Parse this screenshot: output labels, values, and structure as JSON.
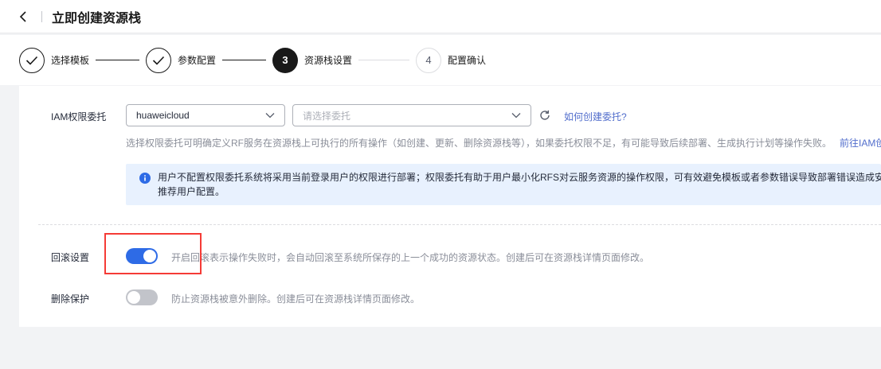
{
  "header": {
    "title": "立即创建资源栈"
  },
  "stepper": {
    "steps": [
      {
        "label": "选择模板",
        "state": "done"
      },
      {
        "label": "参数配置",
        "state": "done"
      },
      {
        "number": "3",
        "label": "资源栈设置",
        "state": "active"
      },
      {
        "number": "4",
        "label": "配置确认",
        "state": "pending"
      }
    ]
  },
  "iam": {
    "label": "IAM权限委托",
    "region_value": "huaweicloud",
    "delegation_placeholder": "请选择委托",
    "help_link": "如何创建委托?",
    "hint": "选择权限委托可明确定义RF服务在资源栈上可执行的所有操作（如创建、更新、删除资源栈等），如果委托权限不足，有可能导致后续部署、生成执行计划等操作失败。",
    "hint_link": "前往IAM创",
    "notice_line1": "用户不配置权限委托系统将采用当前登录用户的权限进行部署；权限委托有助于用户最小化RFS对云服务资源的操作权限，可有效避免模板或者参数错误导致部署错误造成安",
    "notice_line2": "推荐用户配置。"
  },
  "rollback": {
    "label": "回滚设置",
    "enabled": true,
    "description": "开启回滚表示操作失败时，会自动回滚至系统所保存的上一个成功的资源状态。创建后可在资源栈详情页面修改。"
  },
  "deletion_protection": {
    "label": "删除保护",
    "enabled": false,
    "description": "防止资源栈被意外删除。创建后可在资源栈详情页面修改。"
  },
  "colors": {
    "accent": "#2e6be6",
    "link": "#526ecc",
    "highlight": "#f53b36",
    "notice_bg": "#e8f1fe"
  }
}
